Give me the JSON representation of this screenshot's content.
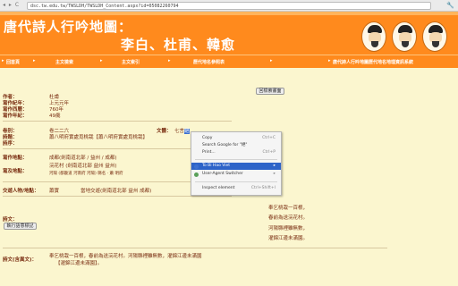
{
  "browser": {
    "nav": "◂ ▸ C",
    "url": "dsc.tw.edu.tw/TWSLDH/TWSLDH_Content.aspx?id=05082260794",
    "wrench": "🔧"
  },
  "banner": {
    "title1": "唐代詩人行吟地圖：",
    "title2": "李白、杜甫、韓愈"
  },
  "menu": [
    {
      "label": "回首頁"
    },
    {
      "label": "主文檢索"
    },
    {
      "label": "主文索引"
    },
    {
      "label": "歷代地名參照表"
    },
    {
      "label": "主文索引"
    },
    {
      "label": "唐代詩人行吟地圖歷代地名地理資訊系統"
    }
  ],
  "back_button": "回檢索畫面",
  "info": {
    "author_label": "作者：",
    "author": "杜甫",
    "year_label": "寫作紀年：",
    "year": "上元元年",
    "ad_label": "寫作西曆：",
    "ad": "760年",
    "age_label": "寫作年紀：",
    "age": "49歲",
    "volume_label": "卷別：",
    "volume": "卷二二六",
    "style_label": "文體：",
    "style_prefix": "七言",
    "style_sel": "絕",
    "title_label": "詩題：",
    "title": "蕭八明府實處覓桃栽【蕭八明府實處覓桃栽】",
    "preface_label": "詩序："
  },
  "places": {
    "write_label": "寫作地點：",
    "write": "成都(劍南道北部 / 益州 / 成都)",
    "where_label": "寫及地點：",
    "where1": "浣花村 (劍南道北部 益州 益州)",
    "where2": "河陽 (都畿道 河南府 河陽) 縣名 · 蕭 明府"
  },
  "contact": {
    "label": "交遊人物/地點：",
    "person": "蕭實",
    "place": "當地交遊(劍南道北部 益州 成都)"
  },
  "poem": {
    "label": "詩文：",
    "button": "執行語意標記",
    "lines": [
      "奉乞桃栽一百根，",
      "春前為送浣花村。",
      "河陽縣裡雖無數，",
      "濯錦江邊未滿園。"
    ]
  },
  "poem_text": {
    "label": "詩文(含異文)：",
    "line1": "奉乞桃栽一百根，春前為送浣花村。河陽縣裡雖無數，濯錦江邊未滿園",
    "line2": "【濯錦江邊未滿園】。"
  },
  "context_menu": {
    "copy": "Copy",
    "copy_sc": "Ctrl+C",
    "search": "Search Google for \"絕\"",
    "print": "Print...",
    "print_sc": "Ctrl+P",
    "translate": "To Bi Hao Viet",
    "translate_sc": "▸",
    "switcher": "User-Agent Switcher",
    "switcher_sc": "▸",
    "inspect": "Inspect element",
    "inspect_sc": "Ctrl+Shift+I"
  }
}
